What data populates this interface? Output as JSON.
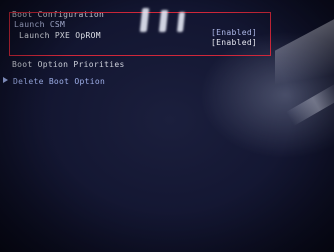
{
  "bios": {
    "section_title": "Boot Configuration",
    "items": [
      {
        "label": "Launch CSM",
        "value": "[Enabled]"
      },
      {
        "label": "Launch PXE OpROM",
        "value": "[Enabled]"
      }
    ],
    "priorities_label": "Boot Option Priorities",
    "delete_option_label": "Delete Boot Option"
  },
  "colors": {
    "highlight_border": "#d0273a",
    "background": "#121530",
    "text_accent": "#9fb0ea"
  },
  "icons": {
    "submenu_marker": "triangle-right-icon"
  }
}
